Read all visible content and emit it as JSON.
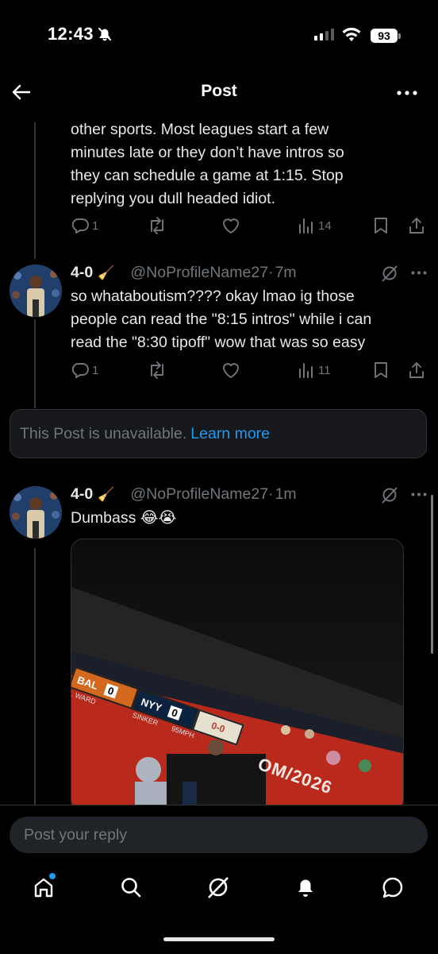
{
  "status_bar": {
    "time": "12:43",
    "battery": "93"
  },
  "header": {
    "title": "Post"
  },
  "tweet_top": {
    "lines": [
      "other sports. Most leagues start a few",
      "minutes late or they don’t have intros so",
      "they can schedule a game at 1:15. Stop",
      "replying you dull headed idiot."
    ],
    "reply_count": "1",
    "views": "14"
  },
  "tweet_mid": {
    "name": "4-0",
    "name_emoji": "🧹",
    "handle": "@NoProfileName27",
    "dot": "·",
    "time": "7m",
    "lines": [
      "so whataboutism???? okay lmao ig those",
      "people can read the \"8:15 intros\" while i can",
      "read the \"8:30 tipoff\" wow that was so easy"
    ],
    "reply_count": "1",
    "views": "11"
  },
  "unavailable": {
    "text": "This Post is unavailable.",
    "link": "Learn more"
  },
  "tweet_bottom": {
    "name": "4-0",
    "name_emoji": "🧹",
    "handle": "@NoProfileName27",
    "dot": "·",
    "time": "1m",
    "text": "Dumbass 😂😭",
    "media": {
      "away_team": "BAL",
      "away_score": "0",
      "home_team": "NYY",
      "home_score": "0",
      "pitcher": "I. WARD",
      "batter": "SINKER",
      "pitch_speed": "95MPH",
      "count": "0-0",
      "outs": "1",
      "banner": "OM/2026"
    }
  },
  "reply_box": {
    "placeholder": "Post your reply"
  },
  "icons": {
    "back": "back-arrow-icon",
    "more": "more-icon",
    "reply": "reply-icon",
    "repost": "repost-icon",
    "like": "heart-icon",
    "views": "views-icon",
    "bookmark": "bookmark-icon",
    "share": "share-icon",
    "grok": "grok-icon",
    "home": "home-icon",
    "search": "search-icon",
    "notifications": "bell-icon",
    "messages": "messages-icon"
  },
  "colors": {
    "accent": "#1d9bf0",
    "background": "#000000",
    "muted": "#71767b"
  }
}
